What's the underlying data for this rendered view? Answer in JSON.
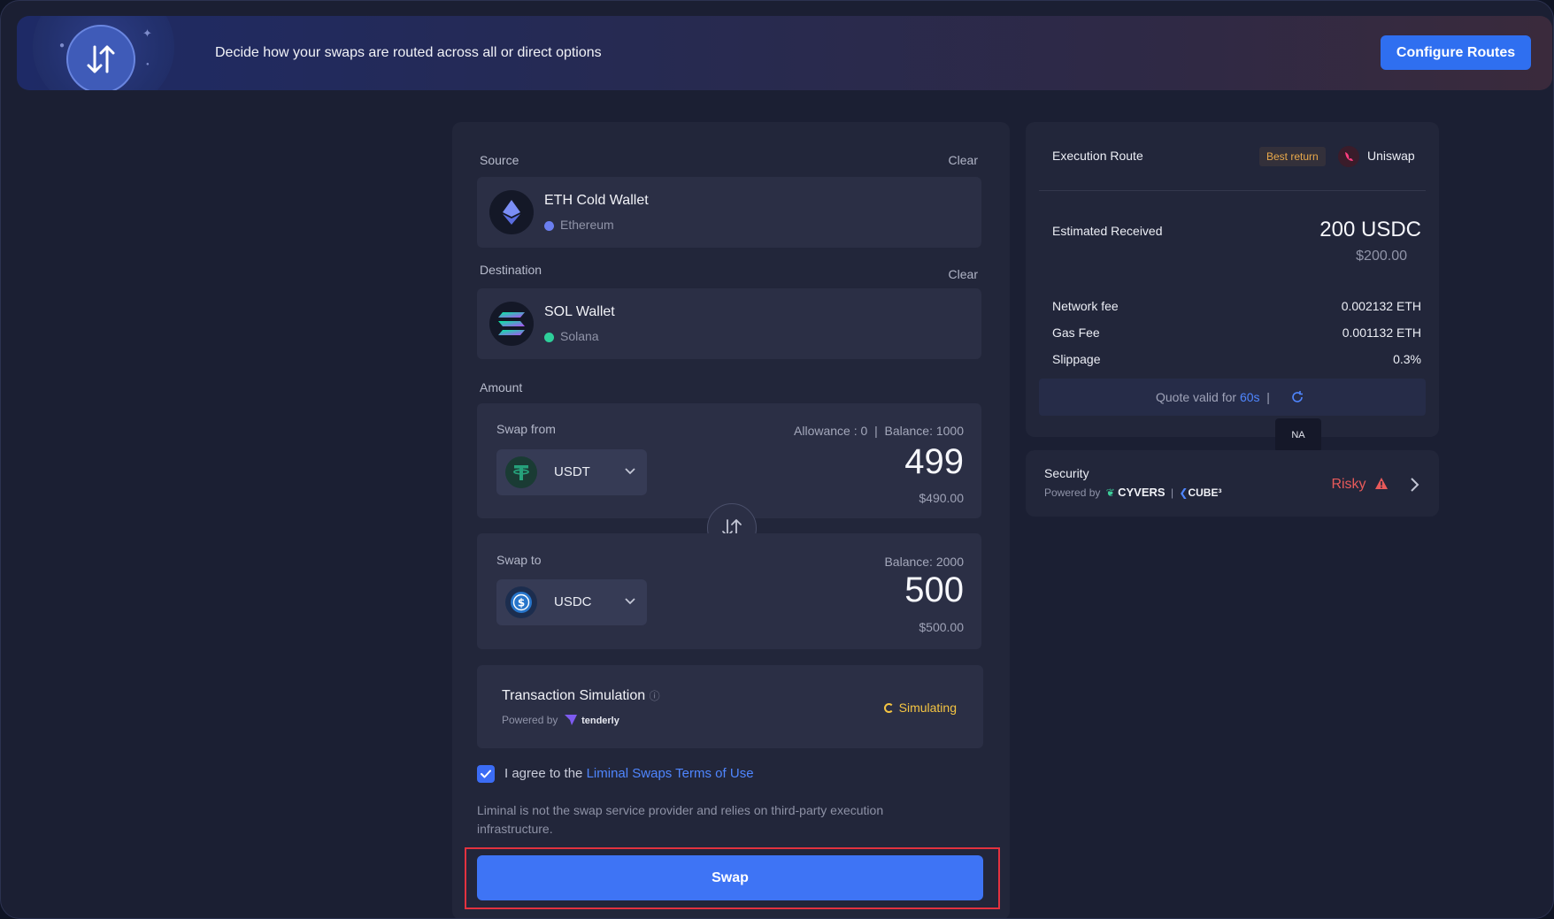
{
  "banner": {
    "text": "Decide how your swaps are routed across all or direct options",
    "configure_label": "Configure Routes"
  },
  "source": {
    "label": "Source",
    "clear": "Clear",
    "wallet_name": "ETH Cold Wallet",
    "network": "Ethereum",
    "network_color": "#6b7ff0"
  },
  "destination": {
    "label": "Destination",
    "clear": "Clear",
    "wallet_name": "SOL Wallet",
    "network": "Solana",
    "network_color": "#2ecf9a"
  },
  "amount": {
    "label": "Amount",
    "swap_from": {
      "label": "Swap from",
      "allowance": "Allowance : 0  |  Balance: 1000",
      "token": "USDT",
      "value": "499",
      "usd": "$490.00"
    },
    "swap_to": {
      "label": "Swap to",
      "balance": "Balance: 2000",
      "token": "USDC",
      "value": "500",
      "usd": "$500.00"
    }
  },
  "simulation": {
    "title": "Transaction Simulation",
    "powered_by": "Powered by",
    "provider": "tenderly",
    "status": "Simulating"
  },
  "terms": {
    "prefix": "I agree to the ",
    "link": "Liminal Swaps Terms of Use",
    "checked": true
  },
  "disclaimer": "Liminal is not the swap service provider and relies on third-party execution infrastructure.",
  "swap_button": "Swap",
  "route": {
    "title": "Execution Route",
    "badge": "Best return",
    "provider": "Uniswap",
    "estimated_label": "Estimated Received",
    "estimated_value": "200 USDC",
    "estimated_usd": "$200.00",
    "fees": [
      {
        "label": "Network fee",
        "value": "0.002132 ETH"
      },
      {
        "label": "Gas Fee",
        "value": "0.001132 ETH"
      },
      {
        "label": "Slippage",
        "value": "0.3%"
      }
    ],
    "quote_prefix": "Quote valid for ",
    "quote_secs": "60s",
    "quote_sep": "  |",
    "tooltip": "NA"
  },
  "security": {
    "title": "Security",
    "powered_by": "Powered by",
    "provider1": "CYVERS",
    "provider2": "CUBE³",
    "status": "Risky"
  }
}
